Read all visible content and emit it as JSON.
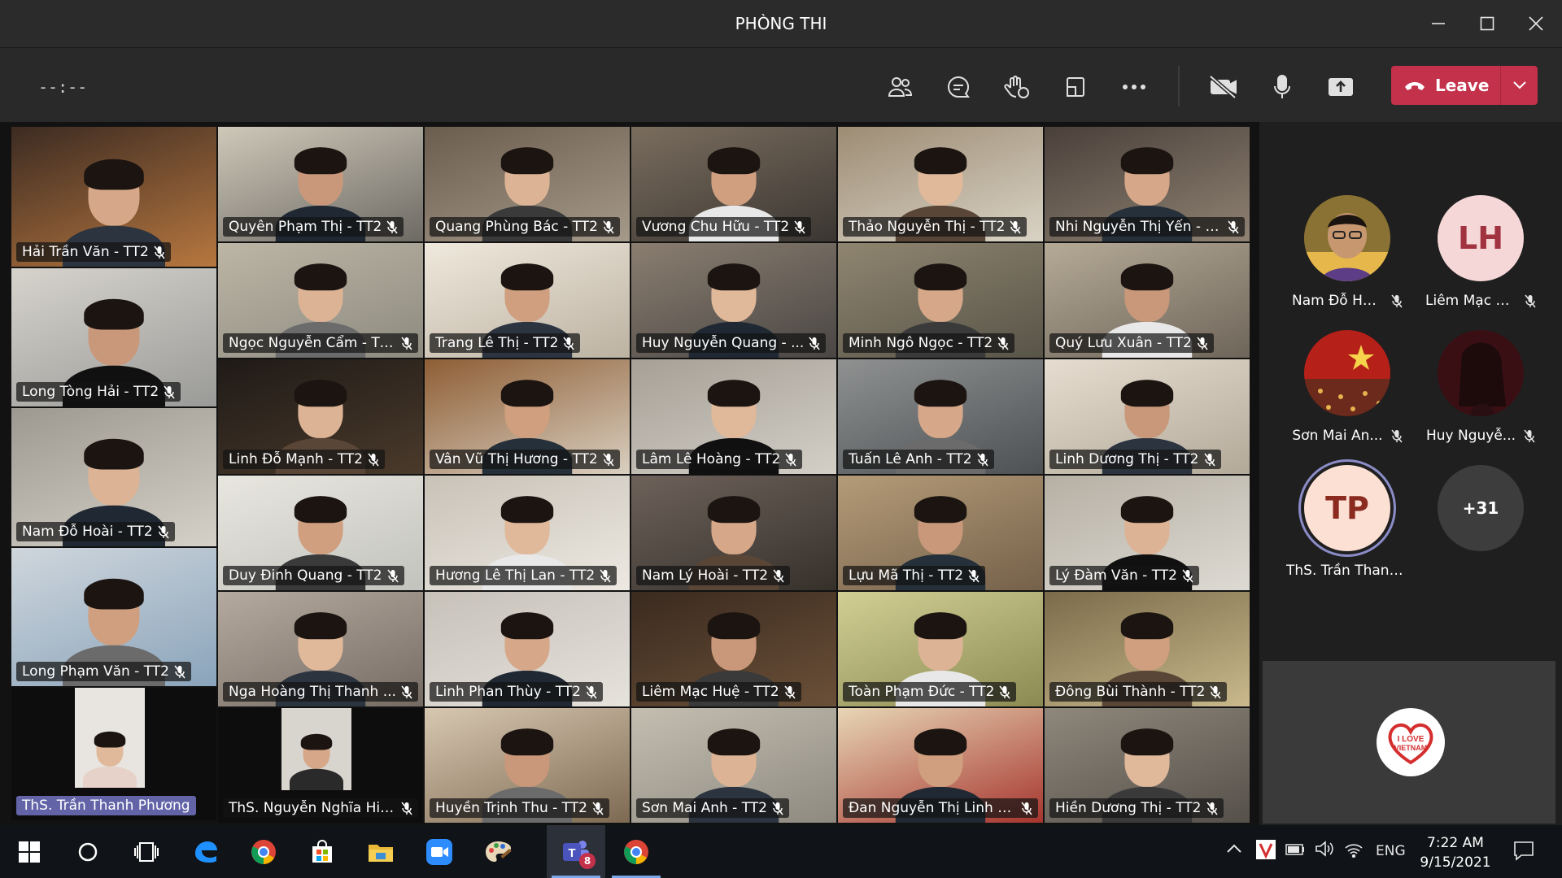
{
  "window": {
    "title": "PHÒNG THI"
  },
  "toolbar": {
    "timer": "--:--",
    "leave_label": "Leave"
  },
  "grid": {
    "tiles": [
      {
        "name": "Hải Trần Văn - TT2"
      },
      {
        "name": "Quyên Phạm Thị - TT2"
      },
      {
        "name": "Quang Phùng Bác - TT2"
      },
      {
        "name": "Vương Chu Hữu - TT2"
      },
      {
        "name": "Thảo Nguyễn Thị - TT2"
      },
      {
        "name": "Nhi Nguyễn Thị Yến - T..."
      },
      {
        "name": "Long Tòng Hải - TT2"
      },
      {
        "name": "Ngọc Nguyễn Cẩm - TT2"
      },
      {
        "name": "Trang Lê Thị - TT2"
      },
      {
        "name": "Huy Nguyễn Quang - ..."
      },
      {
        "name": "Minh Ngô Ngọc - TT2"
      },
      {
        "name": "Quý Lưu Xuân - TT2"
      },
      {
        "name": "Linh Đỗ Mạnh - TT2"
      },
      {
        "name": "Vân Vũ Thị Hương - TT2"
      },
      {
        "name": "Lâm Lê Hoàng - TT2"
      },
      {
        "name": "Tuấn Lê Anh - TT2"
      },
      {
        "name": "Linh Dương Thị - TT2"
      },
      {
        "name": "Nam Đỗ Hoài - TT2"
      },
      {
        "name": "Duy Đinh Quang - TT2"
      },
      {
        "name": "Hương Lê Thị Lan - TT2"
      },
      {
        "name": "Nam Lý Hoài - TT2"
      },
      {
        "name": "Lựu Mã Thị - TT2"
      },
      {
        "name": "Lý Đàm Văn - TT2"
      },
      {
        "name": "Long Phạm Văn - TT2"
      },
      {
        "name": "Nga Hoàng Thị Thanh ..."
      },
      {
        "name": "Linh Phan Thùy - TT2"
      },
      {
        "name": "Liêm Mạc Huệ - TT2"
      },
      {
        "name": "Toàn Phạm Đức - TT2"
      },
      {
        "name": "Đông Bùi Thành - TT2"
      },
      {
        "name": "ThS. Trần Thanh Phương"
      },
      {
        "name": "ThS. Nguyễn Nghĩa Hiệp"
      },
      {
        "name": "Huyền Trịnh Thu - TT2"
      },
      {
        "name": "Sơn Mai Anh - TT2"
      },
      {
        "name": "Đan Nguyễn Thị Linh - ..."
      },
      {
        "name": "Hiền Dương Thị - TT2"
      }
    ]
  },
  "sidebar": {
    "participants": [
      {
        "name": "Nam Đỗ Ho...",
        "initials": ""
      },
      {
        "name": "Liêm Mạc H...",
        "initials": "LH"
      },
      {
        "name": "Sơn Mai An...",
        "initials": ""
      },
      {
        "name": "Huy Nguyễ...",
        "initials": ""
      },
      {
        "name": "ThS. Trần Thanh...",
        "initials": "TP"
      }
    ],
    "overflow_count": "+31",
    "logo_text": "I LOVE VIETNAM"
  },
  "taskbar": {
    "teams_badge": "8",
    "language": "ENG",
    "time": "7:22 AM",
    "date": "9/15/2021"
  },
  "colors": {
    "leave": "#c4314b",
    "host_nameplate": "#6264a7",
    "avatar_lh_bg": "#f6d7d7",
    "avatar_lh_fg": "#a1323f",
    "avatar_tp_bg": "#fbe0d3",
    "avatar_tp_fg": "#8b2a1f"
  }
}
